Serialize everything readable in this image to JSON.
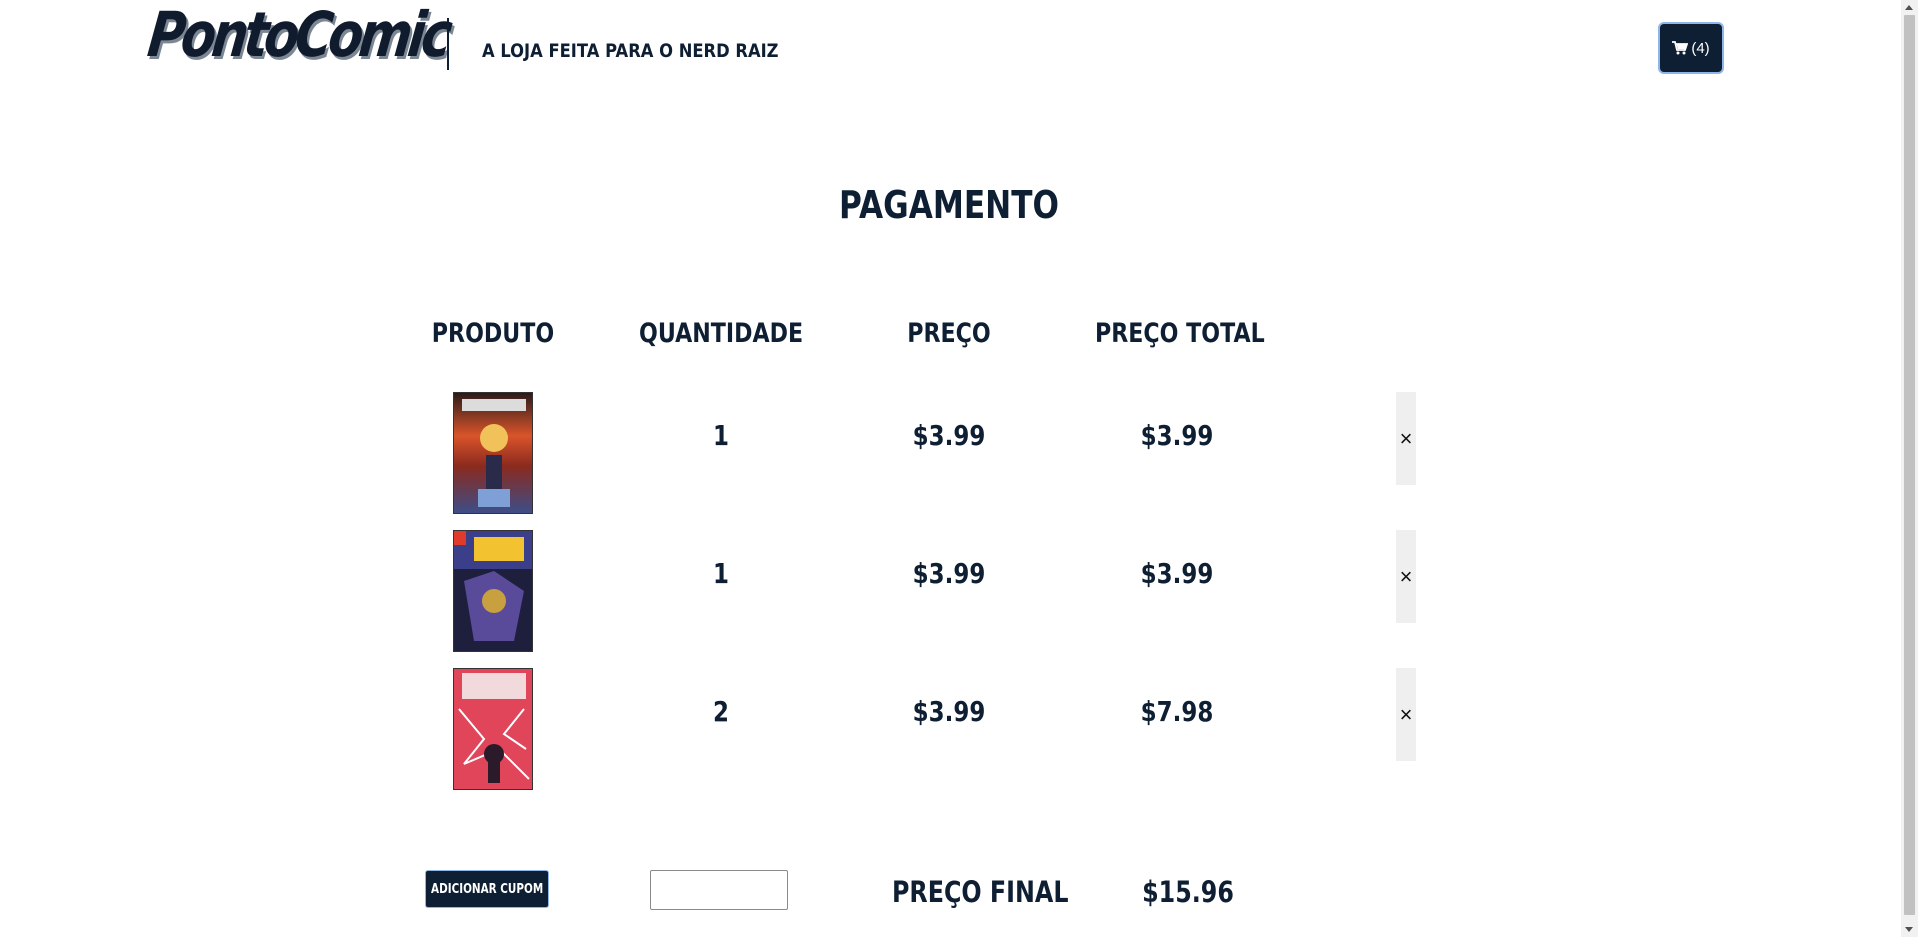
{
  "header": {
    "logo_text": "PontoComic",
    "tagline": "A LOJA FEITA PARA O NERD RAIZ",
    "cart_count_label": "(4)"
  },
  "page_title": "PAGAMENTO",
  "table": {
    "columns": [
      "PRODUTO",
      "QUANTIDADE",
      "PREÇO",
      "PREÇO TOTAL"
    ],
    "rows": [
      {
        "cover": "Vampires comic cover",
        "quantity": "1",
        "price": "$3.99",
        "total": "$3.99",
        "remove_label": "×"
      },
      {
        "cover": "X-Men Legends comic cover",
        "quantity": "1",
        "price": "$3.99",
        "total": "$3.99",
        "remove_label": "×"
      },
      {
        "cover": "Captain America comic cover",
        "quantity": "2",
        "price": "$3.99",
        "total": "$7.98",
        "remove_label": "×"
      }
    ]
  },
  "footer": {
    "coupon_button_label": "ADICIONAR CUPOM",
    "coupon_input_value": "",
    "final_label": "PREÇO FINAL",
    "final_value": "$15.96"
  },
  "colors": {
    "primary": "#0f1f33",
    "accent_border": "#8fb6e8",
    "remove_bg": "#efefef"
  }
}
